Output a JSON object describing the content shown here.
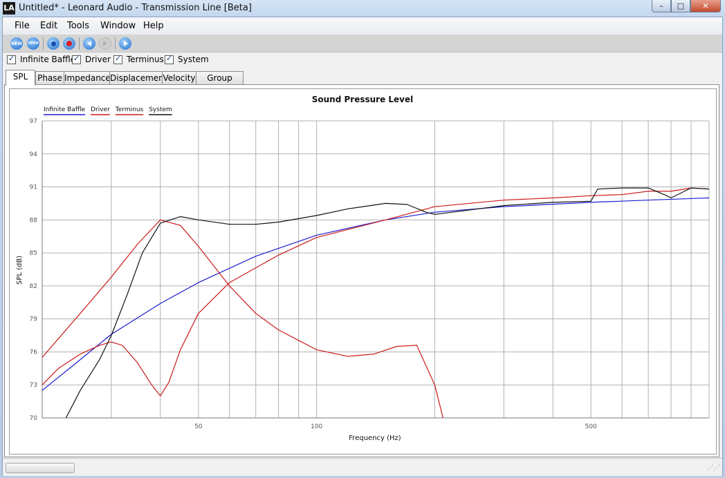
{
  "window": {
    "app_icon": "LA",
    "title": "Untitled* - Leonard Audio - Transmission Line [Beta]",
    "buttons": {
      "minimize": "–",
      "maximize": "□",
      "close": "✕"
    }
  },
  "menu": [
    "File",
    "Edit",
    "Tools",
    "Window",
    "Help"
  ],
  "toolbar": {
    "icons": [
      "new-icon",
      "open-icon",
      "stop-icon",
      "record-icon",
      "back-icon",
      "forward-icon",
      "play-icon"
    ],
    "new_label": "NEW",
    "open_label": "OPEN",
    "colors": {
      "blue": "#1e6fd0",
      "red": "#d81e1e",
      "disabled": "#b7b7b7"
    }
  },
  "checkboxes": [
    {
      "label": "Infinite Baffle",
      "checked": true
    },
    {
      "label": "Driver",
      "checked": true
    },
    {
      "label": "Terminus",
      "checked": true
    },
    {
      "label": "System",
      "checked": true
    }
  ],
  "tabs": [
    "SPL",
    "Phase",
    "Impedance",
    "Displacement",
    "Velocity",
    "Group Delay"
  ],
  "active_tab": "SPL",
  "chart_data": {
    "type": "line",
    "title": "Sound Pressure Level",
    "xlabel": "Frequency (Hz)",
    "ylabel": "SPL (dB)",
    "xscale": "log",
    "xlim": [
      20,
      1000
    ],
    "ylim": [
      70,
      97
    ],
    "grid": true,
    "legend_position": "top-left",
    "x_ticks": [
      50,
      100,
      500
    ],
    "y_ticks": [
      70,
      73,
      76,
      79,
      82,
      85,
      88,
      91,
      94,
      97
    ],
    "series": [
      {
        "name": "Infinite Baffle",
        "color": "#1a1ad0",
        "x": [
          20,
          25,
          30,
          40,
          50,
          70,
          100,
          150,
          200,
          300,
          500,
          700,
          1000
        ],
        "y": [
          72.5,
          75.3,
          77.6,
          80.4,
          82.3,
          84.7,
          86.6,
          88.0,
          88.7,
          89.2,
          89.6,
          89.8,
          90.0
        ]
      },
      {
        "name": "Driver",
        "color": "#cc1a1a",
        "x": [
          20,
          22,
          25,
          28,
          30,
          32,
          35,
          38,
          40,
          42,
          45,
          50,
          60,
          80,
          100,
          150,
          200,
          300,
          400,
          500,
          600,
          700,
          800,
          900,
          1000
        ],
        "y": [
          73.0,
          74.5,
          75.8,
          76.6,
          76.9,
          76.6,
          75.0,
          73.0,
          72.0,
          73.2,
          76.2,
          79.5,
          82.3,
          84.8,
          86.4,
          88.0,
          89.2,
          89.8,
          90.0,
          90.2,
          90.3,
          90.6,
          90.6,
          90.9,
          90.8
        ]
      },
      {
        "name": "Terminus",
        "color": "#cc1a1a",
        "x": [
          20,
          25,
          30,
          35,
          40,
          45,
          50,
          60,
          70,
          80,
          100,
          120,
          140,
          160,
          180,
          200,
          210
        ],
        "y": [
          75.5,
          79.5,
          82.8,
          85.8,
          88.0,
          87.5,
          85.6,
          82.0,
          79.5,
          78.0,
          76.2,
          75.6,
          75.8,
          76.5,
          76.6,
          73.0,
          70.0
        ]
      },
      {
        "name": "System",
        "color": "#111111",
        "x": [
          23,
          25,
          28,
          30,
          33,
          36,
          40,
          45,
          50,
          60,
          70,
          80,
          100,
          120,
          150,
          170,
          190,
          200,
          300,
          400,
          500,
          520,
          600,
          700,
          780,
          800,
          900,
          1000
        ],
        "y": [
          70.0,
          72.5,
          75.3,
          77.5,
          81.3,
          85.0,
          87.7,
          88.3,
          88.0,
          87.6,
          87.6,
          87.8,
          88.4,
          89.0,
          89.5,
          89.4,
          88.7,
          88.5,
          89.3,
          89.6,
          89.7,
          90.8,
          90.9,
          90.9,
          90.2,
          90.0,
          90.9,
          90.8
        ]
      }
    ]
  }
}
